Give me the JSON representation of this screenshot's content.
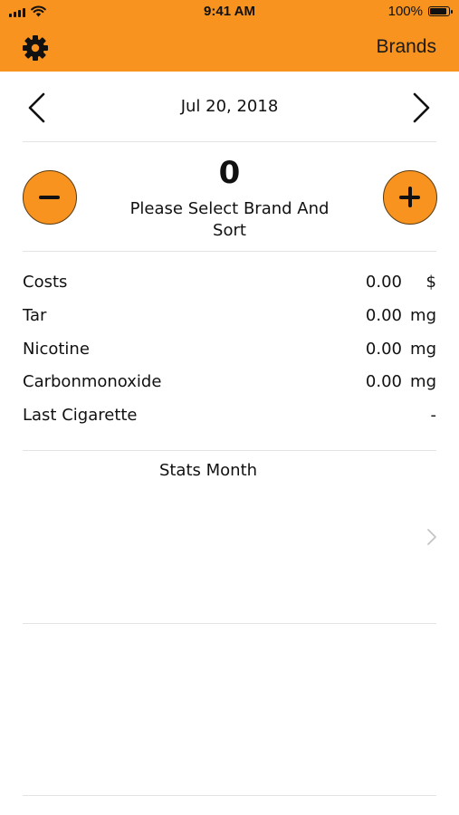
{
  "status_bar": {
    "time": "9:41 AM",
    "battery_text": "100%",
    "battery_level": 1.0,
    "icons": [
      "signal-icon",
      "wifi-icon",
      "battery-icon"
    ]
  },
  "nav": {
    "settings_icon": "gear-icon",
    "brands_label": "Brands",
    "accent_color": "#F7931E"
  },
  "date_nav": {
    "date": "Jul 20, 2018",
    "prev_icon": "chevron-left-icon",
    "next_icon": "chevron-right-icon"
  },
  "counter": {
    "count": "0",
    "hint": "Please Select Brand And Sort",
    "minus_icon": "minus-icon",
    "plus_icon": "plus-icon"
  },
  "stats": [
    {
      "label": "Costs",
      "value": "0.00",
      "unit": "$"
    },
    {
      "label": "Tar",
      "value": "0.00",
      "unit": "mg"
    },
    {
      "label": "Nicotine",
      "value": "0.00",
      "unit": "mg"
    },
    {
      "label": "Carbonmonoxide",
      "value": "0.00",
      "unit": "mg"
    },
    {
      "label": "Last Cigarette",
      "value": "",
      "unit": "-"
    }
  ],
  "stats_month": {
    "title": "Stats Month",
    "disclosure_icon": "chevron-right-icon"
  }
}
